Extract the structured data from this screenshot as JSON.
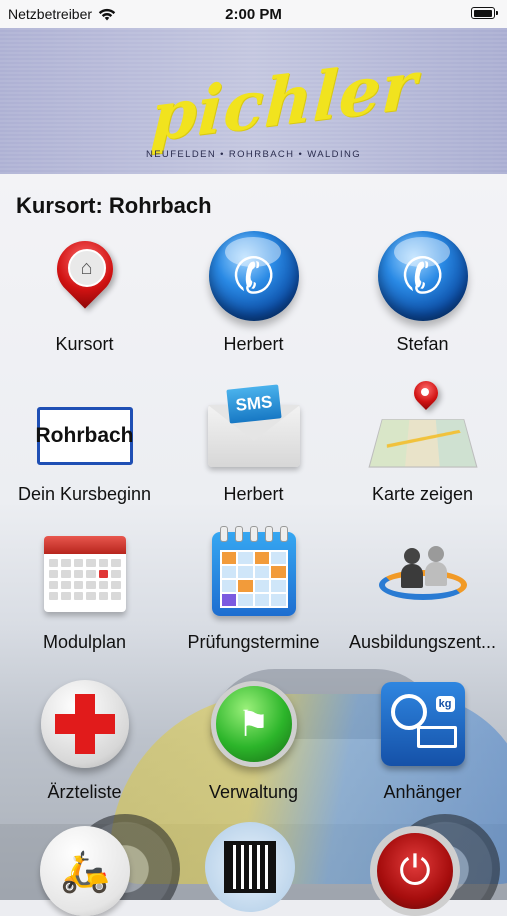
{
  "status_bar": {
    "carrier": "Netzbetreiber",
    "time": "2:00 PM"
  },
  "banner": {
    "logo_text": "pichler",
    "tagline": "NEUFELDEN • ROHRBACH • WALDING"
  },
  "heading": "Kursort: Rohrbach",
  "tiles": [
    {
      "label": "Kursort",
      "icon": "location-pin-icon"
    },
    {
      "label": "Herbert",
      "icon": "phone-icon"
    },
    {
      "label": "Stefan",
      "icon": "phone-icon"
    },
    {
      "label": "Dein Kursbeginn",
      "icon": "town-sign-icon",
      "sign_text": "Rohrbach"
    },
    {
      "label": "Herbert",
      "icon": "sms-envelope-icon",
      "sms_text": "SMS"
    },
    {
      "label": "Karte zeigen",
      "icon": "map-icon"
    },
    {
      "label": "Modulplan",
      "icon": "calendar-icon"
    },
    {
      "label": "Prüfungstermine",
      "icon": "planner-icon"
    },
    {
      "label": "Ausbildungszent...",
      "icon": "people-icon"
    },
    {
      "label": "Ärzteliste",
      "icon": "red-cross-icon"
    },
    {
      "label": "Verwaltung",
      "icon": "flag-icon"
    },
    {
      "label": "Anhänger",
      "icon": "trailer-icon",
      "kg_text": "kg"
    }
  ],
  "partial_row": [
    {
      "icon": "scooter-icon"
    },
    {
      "icon": "qr-code-icon"
    },
    {
      "icon": "power-icon"
    }
  ]
}
